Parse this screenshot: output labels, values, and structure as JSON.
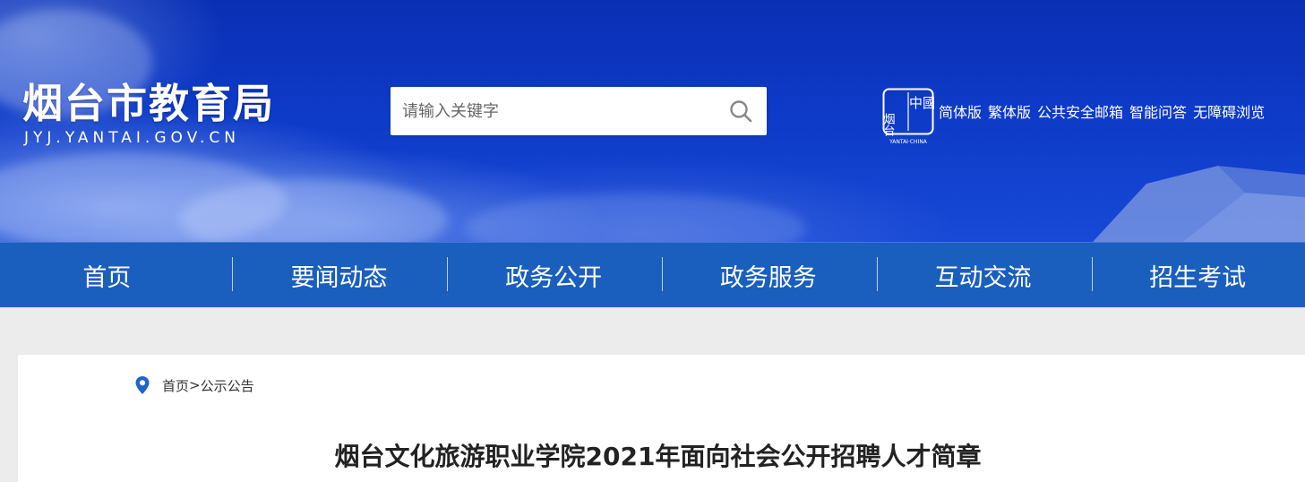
{
  "header": {
    "logo_cn": "烟台市教育局",
    "logo_en": "JYJ.YANTAI.GOV.CN",
    "search": {
      "placeholder": "请输入关键字"
    },
    "seal": {
      "text_top": "中國",
      "text_side": "烟台",
      "caption": "YANTAI·CHINA"
    },
    "links": [
      "简体版",
      "繁体版",
      "公共安全邮箱",
      "智能问答",
      "无障碍浏览"
    ]
  },
  "nav": {
    "items": [
      "首页",
      "要闻动态",
      "政务公开",
      "政务服务",
      "互动交流",
      "招生考试"
    ]
  },
  "breadcrumb": {
    "home": "首页",
    "separator": ">",
    "current": "公示公告"
  },
  "article": {
    "title": "烟台文化旅游职业学院2021年面向社会公开招聘人才简章"
  },
  "colors": {
    "header_blue": "#0d3ac7",
    "nav_blue": "#1a5fbe",
    "page_bg": "#ececec",
    "pin_blue": "#1f64c8"
  }
}
